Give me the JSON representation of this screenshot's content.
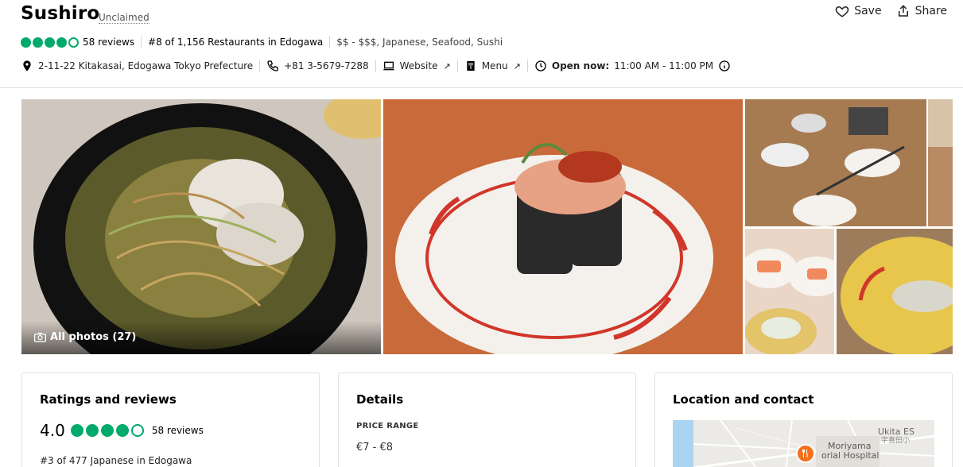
{
  "restaurant": {
    "name": "Sushiro",
    "claim_status": "Unclaimed",
    "rating_bubbles": 4,
    "reviews_count": "58 reviews",
    "ranking": "#8 of 1,156 Restaurants in Edogawa",
    "cuisines": "$$ - $$$, Japanese, Seafood, Sushi"
  },
  "contact": {
    "address": "2-11-22 Kitakasai, Edogawa Tokyo Prefecture",
    "phone": "+81 3-5679-7288",
    "website_label": "Website",
    "menu_label": "Menu",
    "open_label": "Open now:",
    "hours": "11:00 AM - 11:00 PM"
  },
  "actions": {
    "save": "Save",
    "share": "Share"
  },
  "gallery": {
    "all_photos_label": "All photos (27)"
  },
  "cards": {
    "ratings": {
      "title": "Ratings and reviews",
      "score": "4.0",
      "reviews": "58 reviews",
      "rank": "#3 of 477 Japanese in Edogawa"
    },
    "details": {
      "title": "Details",
      "price_range_label": "PRICE RANGE",
      "price_range_value": "€7 - €8"
    },
    "location": {
      "title": "Location and contact",
      "map_labels": [
        "Ukita ES",
        "宇喜田小",
        "Moriyama",
        "orial Hospital"
      ]
    }
  },
  "colors": {
    "rating_green": "#00aa6c",
    "map_pin_orange": "#f2711c"
  }
}
